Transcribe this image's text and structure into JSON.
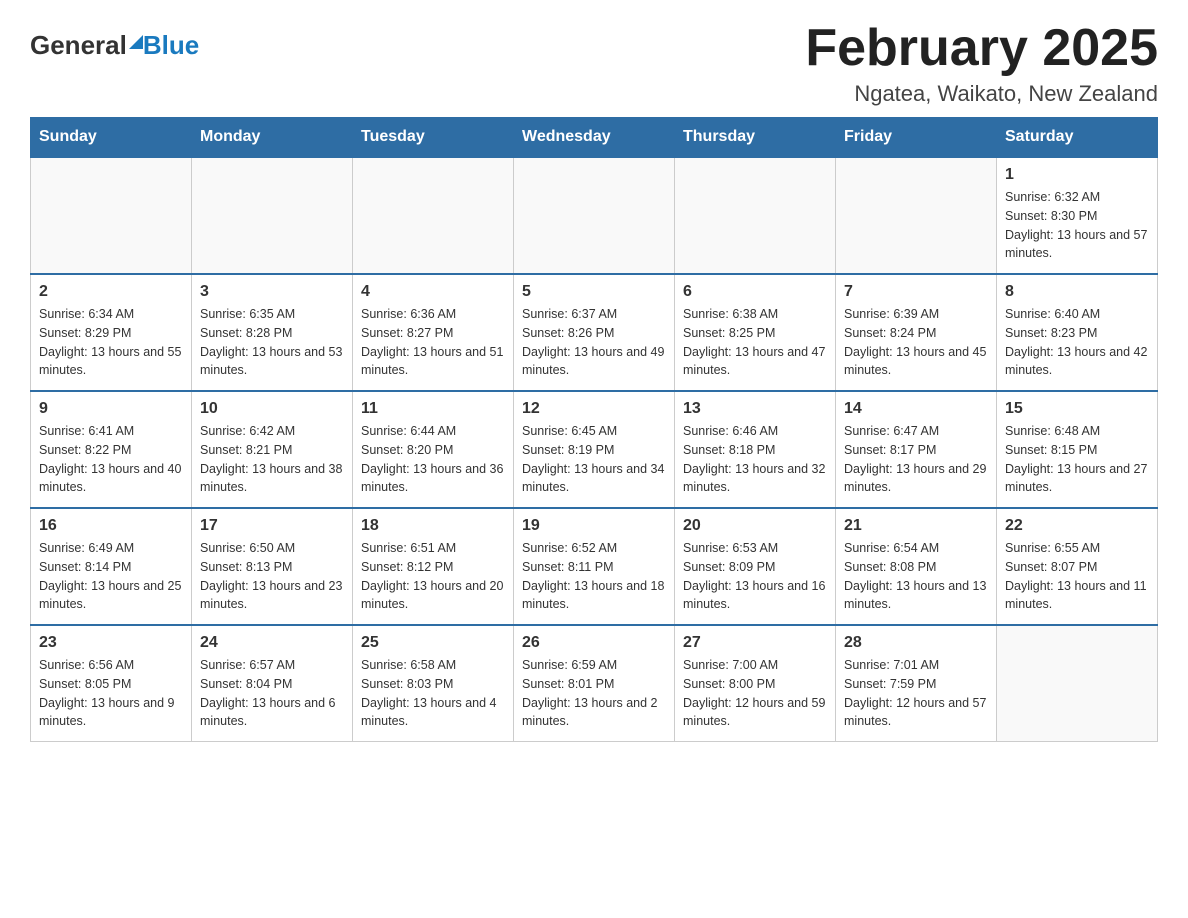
{
  "header": {
    "logo": {
      "general": "General",
      "blue": "Blue"
    },
    "title": "February 2025",
    "subtitle": "Ngatea, Waikato, New Zealand"
  },
  "calendar": {
    "days_of_week": [
      "Sunday",
      "Monday",
      "Tuesday",
      "Wednesday",
      "Thursday",
      "Friday",
      "Saturday"
    ],
    "weeks": [
      [
        {
          "day": "",
          "info": ""
        },
        {
          "day": "",
          "info": ""
        },
        {
          "day": "",
          "info": ""
        },
        {
          "day": "",
          "info": ""
        },
        {
          "day": "",
          "info": ""
        },
        {
          "day": "",
          "info": ""
        },
        {
          "day": "1",
          "info": "Sunrise: 6:32 AM\nSunset: 8:30 PM\nDaylight: 13 hours and 57 minutes."
        }
      ],
      [
        {
          "day": "2",
          "info": "Sunrise: 6:34 AM\nSunset: 8:29 PM\nDaylight: 13 hours and 55 minutes."
        },
        {
          "day": "3",
          "info": "Sunrise: 6:35 AM\nSunset: 8:28 PM\nDaylight: 13 hours and 53 minutes."
        },
        {
          "day": "4",
          "info": "Sunrise: 6:36 AM\nSunset: 8:27 PM\nDaylight: 13 hours and 51 minutes."
        },
        {
          "day": "5",
          "info": "Sunrise: 6:37 AM\nSunset: 8:26 PM\nDaylight: 13 hours and 49 minutes."
        },
        {
          "day": "6",
          "info": "Sunrise: 6:38 AM\nSunset: 8:25 PM\nDaylight: 13 hours and 47 minutes."
        },
        {
          "day": "7",
          "info": "Sunrise: 6:39 AM\nSunset: 8:24 PM\nDaylight: 13 hours and 45 minutes."
        },
        {
          "day": "8",
          "info": "Sunrise: 6:40 AM\nSunset: 8:23 PM\nDaylight: 13 hours and 42 minutes."
        }
      ],
      [
        {
          "day": "9",
          "info": "Sunrise: 6:41 AM\nSunset: 8:22 PM\nDaylight: 13 hours and 40 minutes."
        },
        {
          "day": "10",
          "info": "Sunrise: 6:42 AM\nSunset: 8:21 PM\nDaylight: 13 hours and 38 minutes."
        },
        {
          "day": "11",
          "info": "Sunrise: 6:44 AM\nSunset: 8:20 PM\nDaylight: 13 hours and 36 minutes."
        },
        {
          "day": "12",
          "info": "Sunrise: 6:45 AM\nSunset: 8:19 PM\nDaylight: 13 hours and 34 minutes."
        },
        {
          "day": "13",
          "info": "Sunrise: 6:46 AM\nSunset: 8:18 PM\nDaylight: 13 hours and 32 minutes."
        },
        {
          "day": "14",
          "info": "Sunrise: 6:47 AM\nSunset: 8:17 PM\nDaylight: 13 hours and 29 minutes."
        },
        {
          "day": "15",
          "info": "Sunrise: 6:48 AM\nSunset: 8:15 PM\nDaylight: 13 hours and 27 minutes."
        }
      ],
      [
        {
          "day": "16",
          "info": "Sunrise: 6:49 AM\nSunset: 8:14 PM\nDaylight: 13 hours and 25 minutes."
        },
        {
          "day": "17",
          "info": "Sunrise: 6:50 AM\nSunset: 8:13 PM\nDaylight: 13 hours and 23 minutes."
        },
        {
          "day": "18",
          "info": "Sunrise: 6:51 AM\nSunset: 8:12 PM\nDaylight: 13 hours and 20 minutes."
        },
        {
          "day": "19",
          "info": "Sunrise: 6:52 AM\nSunset: 8:11 PM\nDaylight: 13 hours and 18 minutes."
        },
        {
          "day": "20",
          "info": "Sunrise: 6:53 AM\nSunset: 8:09 PM\nDaylight: 13 hours and 16 minutes."
        },
        {
          "day": "21",
          "info": "Sunrise: 6:54 AM\nSunset: 8:08 PM\nDaylight: 13 hours and 13 minutes."
        },
        {
          "day": "22",
          "info": "Sunrise: 6:55 AM\nSunset: 8:07 PM\nDaylight: 13 hours and 11 minutes."
        }
      ],
      [
        {
          "day": "23",
          "info": "Sunrise: 6:56 AM\nSunset: 8:05 PM\nDaylight: 13 hours and 9 minutes."
        },
        {
          "day": "24",
          "info": "Sunrise: 6:57 AM\nSunset: 8:04 PM\nDaylight: 13 hours and 6 minutes."
        },
        {
          "day": "25",
          "info": "Sunrise: 6:58 AM\nSunset: 8:03 PM\nDaylight: 13 hours and 4 minutes."
        },
        {
          "day": "26",
          "info": "Sunrise: 6:59 AM\nSunset: 8:01 PM\nDaylight: 13 hours and 2 minutes."
        },
        {
          "day": "27",
          "info": "Sunrise: 7:00 AM\nSunset: 8:00 PM\nDaylight: 12 hours and 59 minutes."
        },
        {
          "day": "28",
          "info": "Sunrise: 7:01 AM\nSunset: 7:59 PM\nDaylight: 12 hours and 57 minutes."
        },
        {
          "day": "",
          "info": ""
        }
      ]
    ]
  }
}
